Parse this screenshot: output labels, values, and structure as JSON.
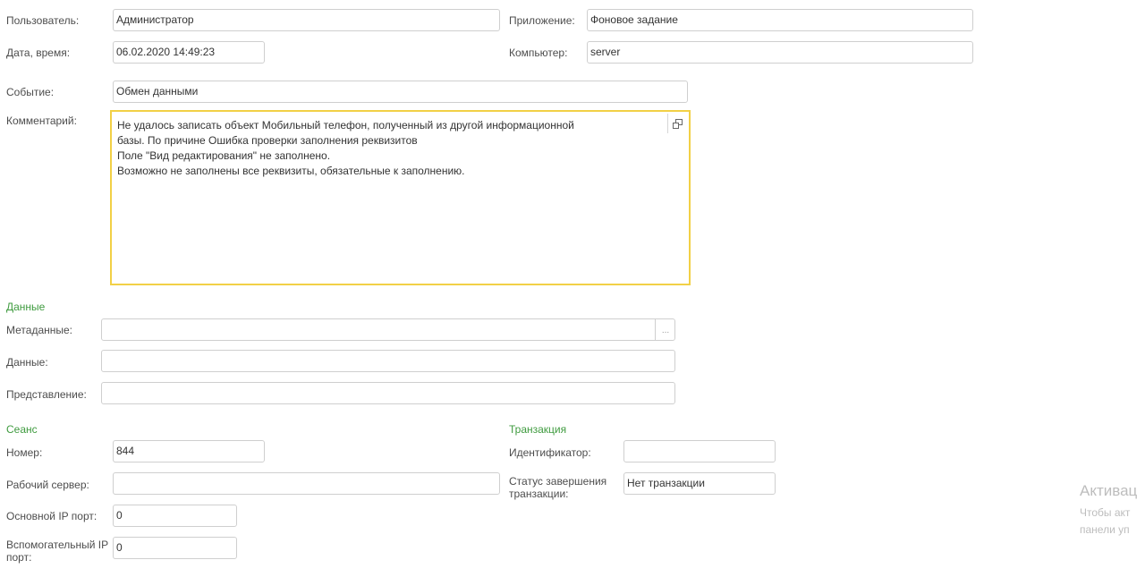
{
  "header": {
    "user_label": "Пользователь:",
    "user_value": "Администратор",
    "app_label": "Приложение:",
    "app_value": "Фоновое задание",
    "datetime_label": "Дата, время:",
    "datetime_value": "06.02.2020 14:49:23",
    "computer_label": "Компьютер:",
    "computer_value": "server",
    "event_label": "Событие:",
    "event_value": "Обмен данными",
    "comment_label": "Комментарий:",
    "comment_value": "Не удалось записать объект Мобильный телефон, полученный из другой информационной\nбазы. По причине Ошибка проверки заполнения реквизитов\nПоле \"Вид редактирования\" не заполнено.\nВозможно не заполнены все реквизиты, обязательные к заполнению.",
    "comment_open_icon": "open-window-icon"
  },
  "data_group": {
    "title": "Данные",
    "metadata_label": "Метаданные:",
    "metadata_value": "",
    "metadata_button": "...",
    "data_label": "Данные:",
    "data_value": "",
    "presentation_label": "Представление:",
    "presentation_value": ""
  },
  "session_group": {
    "title": "Сеанс",
    "number_label": "Номер:",
    "number_value": "844",
    "server_label": "Рабочий сервер:",
    "server_value": "",
    "main_port_label": "Основной IP порт:",
    "main_port_value": "0",
    "aux_port_label": "Вспомогательный IP порт:",
    "aux_port_value": "0"
  },
  "transaction_group": {
    "title": "Транзакция",
    "id_label": "Идентификатор:",
    "id_value": "",
    "status_label": "Статус завершения транзакции:",
    "status_value": "Нет транзакции"
  },
  "watermark": {
    "title": "Активац",
    "line1": "Чтобы акт",
    "line2": "панели уп"
  }
}
